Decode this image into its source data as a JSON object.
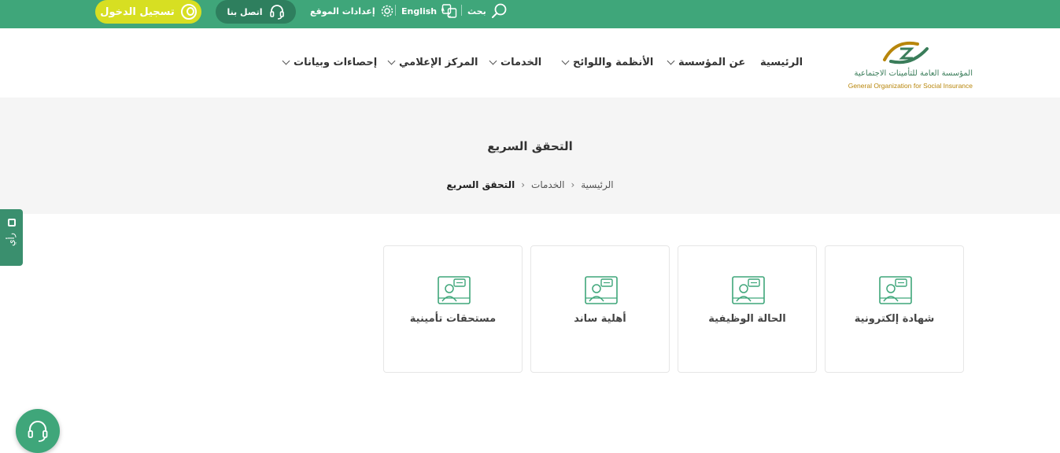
{
  "topbar": {
    "login_label": "تسجيل الدخول",
    "contact_label": "اتصل بنا",
    "site_settings_label": "إعدادات الموقع",
    "language_label": "English",
    "search_label": "بحث"
  },
  "logo": {
    "arabic_name": "المؤسسة العامة للتأمينات الاجتماعية",
    "english_name": "General Organization for Social Insurance"
  },
  "nav": {
    "items": [
      {
        "label": "الرئيسية",
        "has_dropdown": false
      },
      {
        "label": "عن المؤسسة",
        "has_dropdown": true
      },
      {
        "label": "الأنظمة واللوائح",
        "has_dropdown": true
      },
      {
        "label": "الخدمات",
        "has_dropdown": true
      },
      {
        "label": "المركز الإعلامي",
        "has_dropdown": true
      },
      {
        "label": "إحصاءات وبيانات",
        "has_dropdown": true
      }
    ]
  },
  "hero": {
    "title": "التحقق السريع",
    "breadcrumb": [
      "الرئيسية",
      "الخدمات",
      "التحقق السريع"
    ]
  },
  "feedback": {
    "label": "رأي"
  },
  "cards": [
    {
      "label": "شهادة إلكترونية"
    },
    {
      "label": "الحالة الوظيفية"
    },
    {
      "label": "أهلية ساند"
    },
    {
      "label": "مستحقات تأمينية"
    }
  ],
  "colors": {
    "primary_green": "#3fa67a",
    "dark_green": "#2e7f5e",
    "accent_yellow": "#d7df22",
    "hero_bg": "#f5f5f5"
  }
}
